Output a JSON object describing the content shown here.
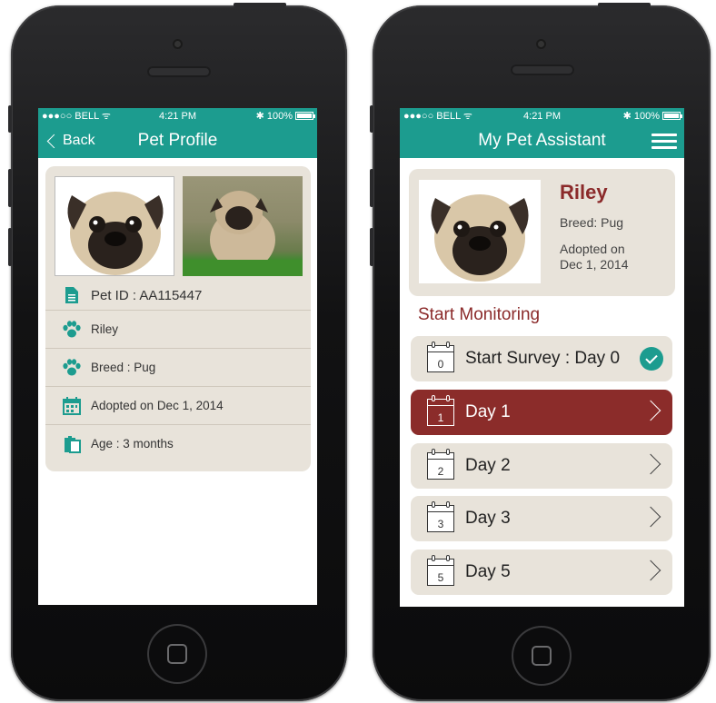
{
  "status_bar": {
    "carrier": "●●●○○ BELL ᯤ",
    "time": "4:21 PM",
    "bluetooth": "✱",
    "battery": "100%"
  },
  "profile_screen": {
    "back_label": "Back",
    "title": "Pet Profile",
    "rows": [
      {
        "icon": "document-icon",
        "text": "Pet ID : AA115447"
      },
      {
        "icon": "paw-icon",
        "text": "Riley"
      },
      {
        "icon": "paw-icon",
        "text": "Breed : Pug"
      },
      {
        "icon": "calendar-icon",
        "text": "Adopted on Dec 1, 2014"
      },
      {
        "icon": "clipboard-icon",
        "text": "Age : 3 months"
      }
    ]
  },
  "assistant_screen": {
    "title": "My Pet Assistant",
    "pet_name": "Riley",
    "breed": "Breed: Pug",
    "adopted": "Adopted on Dec 1, 2014",
    "section_title": "Start Monitoring",
    "days": [
      {
        "num": "0",
        "label": "Start Survey : Day 0",
        "state": "completed"
      },
      {
        "num": "1",
        "label": "Day 1",
        "state": "active"
      },
      {
        "num": "2",
        "label": "Day 2",
        "state": "default"
      },
      {
        "num": "3",
        "label": "Day 3",
        "state": "default"
      },
      {
        "num": "5",
        "label": "Day 5",
        "state": "default"
      }
    ]
  },
  "colors": {
    "teal": "#1c9c8f",
    "maroon": "#8b2c2a",
    "card": "#e8e3da"
  }
}
